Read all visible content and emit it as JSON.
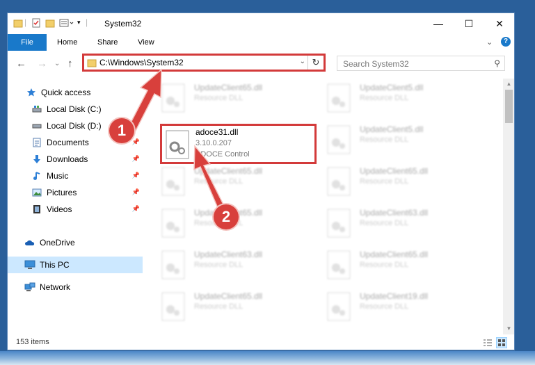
{
  "window": {
    "title": "System32",
    "minimize_glyph": "—",
    "maximize_glyph": "☐",
    "close_glyph": "✕"
  },
  "ribbon": {
    "tabs": [
      {
        "label": "File"
      },
      {
        "label": "Home"
      },
      {
        "label": "Share"
      },
      {
        "label": "View"
      }
    ],
    "expand_glyph": "⌄",
    "help_glyph": "?"
  },
  "navigation": {
    "back_glyph": "←",
    "forward_glyph": "→",
    "recent_glyph": "⌄",
    "up_glyph": "↑"
  },
  "address": {
    "path": "C:\\Windows\\System32",
    "dropdown_glyph": "⌄",
    "refresh_glyph": "↻"
  },
  "search": {
    "placeholder": "Search System32",
    "icon_glyph": "⚲"
  },
  "nav_pane": {
    "items": [
      {
        "label": "Quick access"
      },
      {
        "label": "Local Disk (C:)"
      },
      {
        "label": "Local Disk (D:)"
      },
      {
        "label": "Documents"
      },
      {
        "label": "Downloads"
      },
      {
        "label": "Music"
      },
      {
        "label": "Pictures"
      },
      {
        "label": "Videos"
      },
      {
        "label": "OneDrive"
      },
      {
        "label": "This PC"
      },
      {
        "label": "Network"
      }
    ],
    "pin_glyph": "📌"
  },
  "files": {
    "background": [
      {
        "name": "UpdateClient65.dll",
        "desc": "Resource DLL"
      },
      {
        "name": "UpdateClient5.dll",
        "desc": "Resource DLL"
      },
      {
        "name": "UpdateClient5.dll",
        "desc": "Resource DLL"
      },
      {
        "name": "UpdateClient65.dll",
        "desc": "Resource DLL"
      },
      {
        "name": "UpdateClient65.dll",
        "desc": "Resource DLL"
      },
      {
        "name": "UpdateClient65.dll",
        "desc": "Resource DLL"
      },
      {
        "name": "UpdateClient63.dll",
        "desc": "Resource DLL"
      },
      {
        "name": "UpdateClient63.dll",
        "desc": "Resource DLL"
      },
      {
        "name": "UpdateClient65.dll",
        "desc": "Resource DLL"
      },
      {
        "name": "UpdateClient65.dll",
        "desc": "Resource DLL"
      },
      {
        "name": "UpdateClient19.dll",
        "desc": "Resource DLL"
      }
    ],
    "highlighted": {
      "name": "adoce31.dll",
      "version": "3.10.0.207",
      "description": "ADOCE Control"
    }
  },
  "status": {
    "item_count": "153 items"
  },
  "annotations": {
    "step1": "1",
    "step2": "2",
    "color": "#d8403c"
  }
}
